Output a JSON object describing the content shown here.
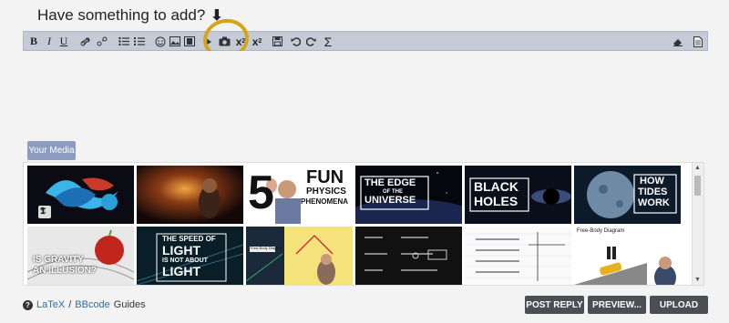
{
  "heading": {
    "text": "Have something to add?",
    "arrow": "🡇"
  },
  "toolbar": {
    "bold": "B",
    "italic": "I",
    "underline": "U",
    "subscript": "x",
    "subscript_small": "2",
    "superscript": "x",
    "superscript_small": "2",
    "sigma": "Σ"
  },
  "media": {
    "label": "Your Media"
  },
  "thumbnails": [
    {
      "text": "",
      "icon": "nyt-logo"
    },
    {
      "text": ""
    },
    {
      "text": "5 FUN PHYSICS PHENOMENA",
      "big": "5",
      "line1": "FUN",
      "line2": "PHYSICS",
      "line3": "PHENOMENA"
    },
    {
      "line1": "THE EDGE",
      "line2": "OF THE",
      "line3": "UNIVERSE"
    },
    {
      "line1": "BLACK",
      "line2": "HOLES"
    },
    {
      "line1": "HOW",
      "line2": "TIDES",
      "line3": "WORK"
    },
    {
      "line1": "IS GRAVITY",
      "line2": "AN ILLUSION?"
    },
    {
      "line1": "THE SPEED OF",
      "line2": "LIGHT",
      "line3": "IS NOT ABOUT",
      "line4": "LIGHT"
    },
    {
      "text": "Free-Body Diagram"
    },
    {
      "text": ""
    },
    {
      "text": ""
    },
    {
      "text": "Free-Body Diagram"
    }
  ],
  "footer": {
    "help_icon": "?",
    "latex": "LaTeX",
    "sep": " / ",
    "bbcode": "BBcode",
    "guides": " Guides",
    "post_reply": "POST REPLY",
    "preview": "PREVIEW...",
    "upload": "UPLOAD"
  },
  "colors": {
    "toolbar_bg": "#c4cad6",
    "button_bg": "#4b4f54",
    "highlight": "#d4a51a",
    "media_btn": "#8d9cbf"
  }
}
